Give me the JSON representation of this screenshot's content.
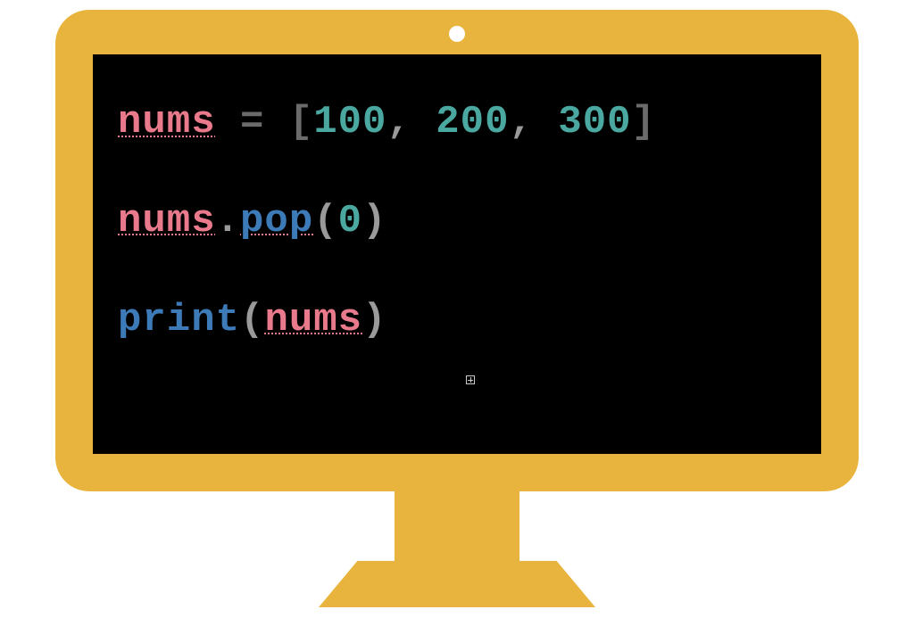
{
  "code": {
    "line1": {
      "var": "nums",
      "assign": " = ",
      "lbracket": "[",
      "n1": "100",
      "c1": ", ",
      "n2": "200",
      "c2": ", ",
      "n3": "300",
      "rbracket": "]"
    },
    "line2": {
      "var": "nums",
      "dot": ".",
      "method": "pop",
      "lparen": "(",
      "arg": "0",
      "rparen": ")"
    },
    "line3": {
      "builtin": "print",
      "lparen": "(",
      "var": "nums",
      "rparen": ")"
    }
  }
}
